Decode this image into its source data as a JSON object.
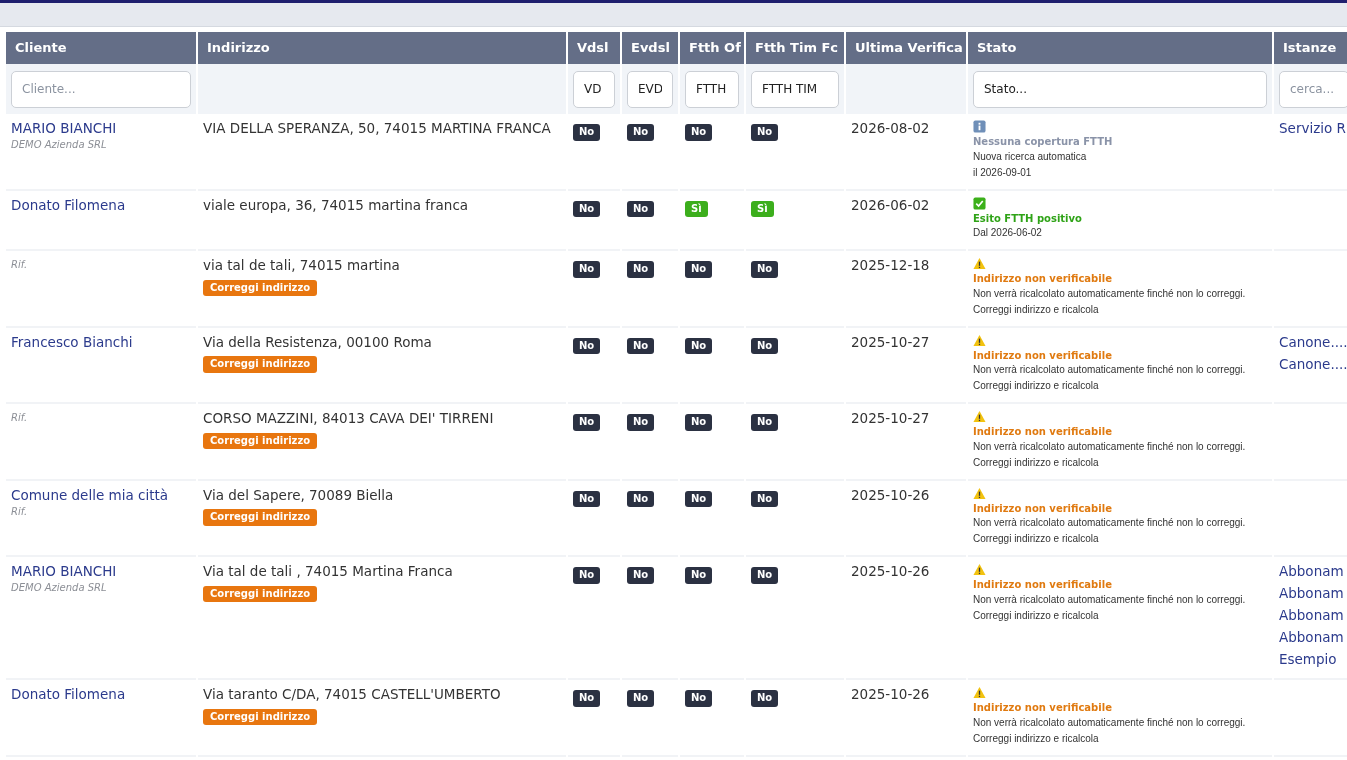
{
  "table": {
    "columns": [
      "Cliente",
      "Indirizzo",
      "Vdsl",
      "Evdsl",
      "Ftth Of",
      "Ftth Tim Fc",
      "Ultima Verifica",
      "Stato",
      "Istanze"
    ],
    "filters": [
      {
        "kind": "input",
        "placeholder": "Cliente..."
      },
      {
        "kind": "none"
      },
      {
        "kind": "input",
        "value": "VD"
      },
      {
        "kind": "input",
        "value": "EVD"
      },
      {
        "kind": "input",
        "value": "FTTH"
      },
      {
        "kind": "input",
        "value": "FTTH TIM"
      },
      {
        "kind": "none"
      },
      {
        "kind": "input",
        "value": "Stato..."
      },
      {
        "kind": "input",
        "placeholder": "cerca..."
      }
    ],
    "rows": [
      {
        "client": "MARIO BIANCHI",
        "client_sub": "DEMO Azienda SRL",
        "address": "VIA DELLA SPERANZA, 50, 74015 MARTINA FRANCA",
        "flags": [
          {
            "label": "No",
            "positive": false
          },
          {
            "label": "No",
            "positive": false
          },
          {
            "label": "No",
            "positive": false
          },
          {
            "label": "No",
            "positive": false
          }
        ],
        "verified": "2026-08-02",
        "status": {
          "kind": "info",
          "title": "Nessuna copertura FTTH",
          "lines": [
            "Nuova ricerca automatica",
            "il 2026-09-01"
          ]
        },
        "instances": [
          "Servizio R"
        ]
      },
      {
        "client": "Donato Filomena",
        "address": "viale europa, 36, 74015 martina franca",
        "flags": [
          {
            "label": "No",
            "positive": false
          },
          {
            "label": "No",
            "positive": false
          },
          {
            "label": "Sì",
            "positive": true
          },
          {
            "label": "Sì",
            "positive": true
          }
        ],
        "verified": "2026-06-02",
        "status": {
          "kind": "ok",
          "title": "Esito FTTH positivo",
          "lines": [
            "Dal 2026-06-02"
          ]
        }
      },
      {
        "client_sub": "Rif.",
        "address": "via tal de tali, 74015 martina",
        "fix_button": "Correggi indirizzo",
        "flags": [
          {
            "label": "No",
            "positive": false
          },
          {
            "label": "No",
            "positive": false
          },
          {
            "label": "No",
            "positive": false
          },
          {
            "label": "No",
            "positive": false
          }
        ],
        "verified": "2025-12-18",
        "status": {
          "kind": "warn",
          "title": "Indirizzo non verificabile",
          "lines": [
            "Non verrà ricalcolato automaticamente finché non lo correggi.",
            "Correggi indirizzo e ricalcola"
          ]
        }
      },
      {
        "client": "Francesco Bianchi",
        "address": "Via della Resistenza, 00100 Roma",
        "fix_button": "Correggi indirizzo",
        "flags": [
          {
            "label": "No",
            "positive": false
          },
          {
            "label": "No",
            "positive": false
          },
          {
            "label": "No",
            "positive": false
          },
          {
            "label": "No",
            "positive": false
          }
        ],
        "verified": "2025-10-27",
        "status": {
          "kind": "warn",
          "title": "Indirizzo non verificabile",
          "lines": [
            "Non verrà ricalcolato automaticamente finché non lo correggi.",
            "Correggi indirizzo e ricalcola"
          ]
        },
        "instances": [
          "Canone....",
          "Canone...."
        ]
      },
      {
        "client_sub": "Rif.",
        "address": "CORSO MAZZINI, 84013 CAVA DEI' TIRRENI",
        "fix_button": "Correggi indirizzo",
        "flags": [
          {
            "label": "No",
            "positive": false
          },
          {
            "label": "No",
            "positive": false
          },
          {
            "label": "No",
            "positive": false
          },
          {
            "label": "No",
            "positive": false
          }
        ],
        "verified": "2025-10-27",
        "status": {
          "kind": "warn",
          "title": "Indirizzo non verificabile",
          "lines": [
            "Non verrà ricalcolato automaticamente finché non lo correggi.",
            "Correggi indirizzo e ricalcola"
          ]
        }
      },
      {
        "client": "Comune delle mia città",
        "client_sub": "Rif.",
        "address": "Via del Sapere, 70089 Biella",
        "fix_button": "Correggi indirizzo",
        "flags": [
          {
            "label": "No",
            "positive": false
          },
          {
            "label": "No",
            "positive": false
          },
          {
            "label": "No",
            "positive": false
          },
          {
            "label": "No",
            "positive": false
          }
        ],
        "verified": "2025-10-26",
        "status": {
          "kind": "warn",
          "title": "Indirizzo non verificabile",
          "lines": [
            "Non verrà ricalcolato automaticamente finché non lo correggi.",
            "Correggi indirizzo e ricalcola"
          ]
        }
      },
      {
        "client": "MARIO BIANCHI",
        "client_sub": "DEMO Azienda SRL",
        "address": "Via tal de tali , 74015 Martina Franca",
        "fix_button": "Correggi indirizzo",
        "flags": [
          {
            "label": "No",
            "positive": false
          },
          {
            "label": "No",
            "positive": false
          },
          {
            "label": "No",
            "positive": false
          },
          {
            "label": "No",
            "positive": false
          }
        ],
        "verified": "2025-10-26",
        "status": {
          "kind": "warn",
          "title": "Indirizzo non verificabile",
          "lines": [
            "Non verrà ricalcolato automaticamente finché non lo correggi.",
            "Correggi indirizzo e ricalcola"
          ]
        },
        "instances": [
          "Abbonam",
          "Abbonam",
          "Abbonam",
          "Abbonam",
          "Esempio"
        ]
      },
      {
        "client": "Donato Filomena",
        "address": "Via taranto C/DA, 74015 CASTELL'UMBERTO",
        "fix_button": "Correggi indirizzo",
        "flags": [
          {
            "label": "No",
            "positive": false
          },
          {
            "label": "No",
            "positive": false
          },
          {
            "label": "No",
            "positive": false
          },
          {
            "label": "No",
            "positive": false
          }
        ],
        "verified": "2025-10-26",
        "status": {
          "kind": "warn",
          "title": "Indirizzo non verificabile",
          "lines": [
            "Non verrà ricalcolato automaticamente finché non lo correggi.",
            "Correggi indirizzo e ricalcola"
          ]
        }
      }
    ]
  }
}
